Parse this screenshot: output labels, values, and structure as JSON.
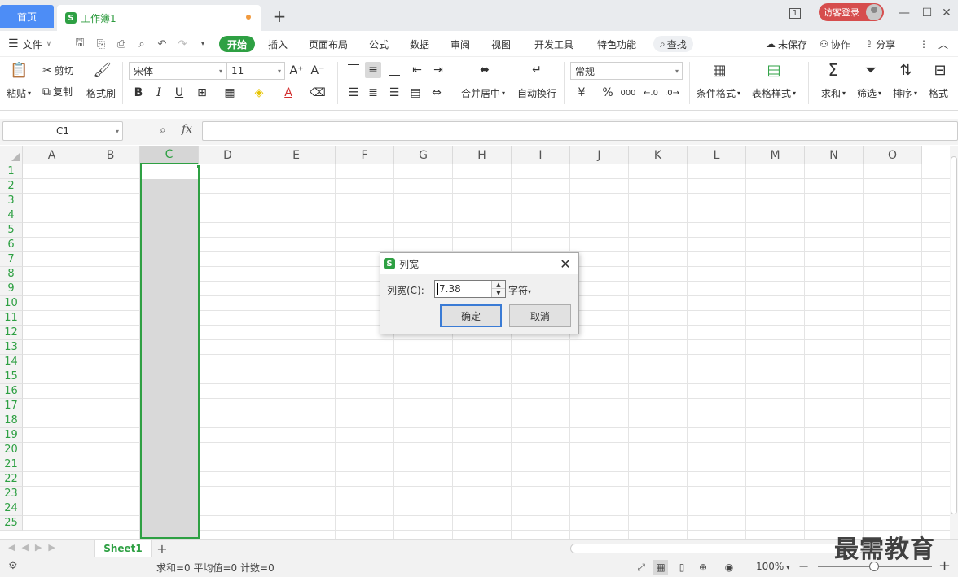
{
  "titlebar": {
    "home_tab": "首页",
    "doc_tab": "工作簿1",
    "logo_letter": "S",
    "new_tab": "+",
    "page_indicator": "1",
    "login": "访客登录"
  },
  "menubar": {
    "file": "文件",
    "tabs": [
      "开始",
      "插入",
      "页面布局",
      "公式",
      "数据",
      "审阅",
      "视图",
      "开发工具",
      "特色功能"
    ],
    "active_tab": "开始",
    "search": "查找",
    "unsaved": "未保存",
    "collab": "协作",
    "share": "分享"
  },
  "ribbon": {
    "paste": "粘贴",
    "cut": "剪切",
    "copy": "复制",
    "format_painter": "格式刷",
    "font_name": "宋体",
    "font_size": "11",
    "bold": "B",
    "italic": "I",
    "underline": "U",
    "merge_center": "合并居中",
    "wrap_text": "自动换行",
    "number_format": "常规",
    "currency": "¥",
    "percent": "%",
    "thousands": "000",
    "cond_format": "条件格式",
    "table_style": "表格样式",
    "sum": "求和",
    "filter": "筛选",
    "sort": "排序",
    "format": "格式"
  },
  "formulabar": {
    "name_box": "C1",
    "fx": "fx",
    "formula": ""
  },
  "grid": {
    "columns": [
      "A",
      "B",
      "C",
      "D",
      "E",
      "F",
      "G",
      "H",
      "I",
      "J",
      "K",
      "L",
      "M",
      "N",
      "O"
    ],
    "rows": [
      "1",
      "2",
      "3",
      "4",
      "5",
      "6",
      "7",
      "8",
      "9",
      "10",
      "11",
      "12",
      "13",
      "14",
      "15",
      "16",
      "17",
      "18",
      "19",
      "20",
      "21",
      "22",
      "23",
      "24",
      "25"
    ],
    "selected_column": "C"
  },
  "sheetbar": {
    "sheet_name": "Sheet1",
    "add": "+"
  },
  "statusbar": {
    "summary": "求和=0  平均值=0  计数=0",
    "zoom": "100%",
    "minus": "−",
    "plus": "+"
  },
  "dialog": {
    "title": "列宽",
    "logo_letter": "S",
    "label": "列宽(C):",
    "value": "7.38",
    "unit": "字符",
    "ok": "确定",
    "cancel": "取消",
    "close": "✕"
  },
  "watermark": "最需教育"
}
